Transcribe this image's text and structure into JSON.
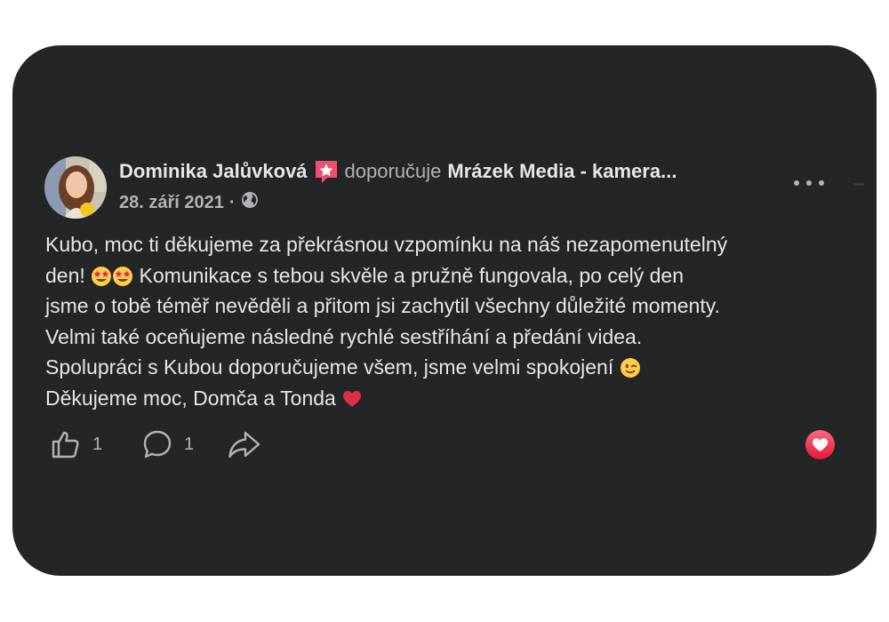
{
  "post": {
    "author": "Dominika Jalůvková",
    "recommends_label": "doporučuje",
    "page_name": "Mrázek Media - kamera...",
    "date": "28. září 2021",
    "separator": "·",
    "privacy_icon": "globe-icon",
    "badge_icon": "recommendation-star-icon",
    "text": {
      "line1": "Kubo, moc ti děkujeme za překrásnou vzpomínku na náš nezapomenutelný",
      "line2_prefix": "den!",
      "line2_suffix": "Komunikace s tebou skvěle a pružně fungovala, po celý den",
      "line3": "jsme o tobě téměř nevěděli a přitom jsi zachytil všechny důležité momenty.",
      "line4": "Velmi také oceňujeme následné rychlé sestříhání a předání videa.",
      "line5": "Spolupráci s Kubou doporučujeme všem, jsme velmi spokojení",
      "line6": "Děkujeme moc, Domča a Tonda"
    },
    "emojis": [
      "star-struck-emoji",
      "star-struck-emoji",
      "winking-face-emoji",
      "red-heart-emoji"
    ]
  },
  "actions": {
    "like_count": "1",
    "comment_count": "1",
    "like_icon": "thumbs-up-icon",
    "comment_icon": "comment-bubble-icon",
    "share_icon": "share-arrow-icon"
  },
  "reaction": {
    "icon": "love-reaction-icon",
    "color": "#f33e58"
  },
  "colors": {
    "card_bg": "#242526",
    "primary_text": "#e4e6eb",
    "secondary_text": "#b0b3b8",
    "badge": "#f0506e"
  }
}
